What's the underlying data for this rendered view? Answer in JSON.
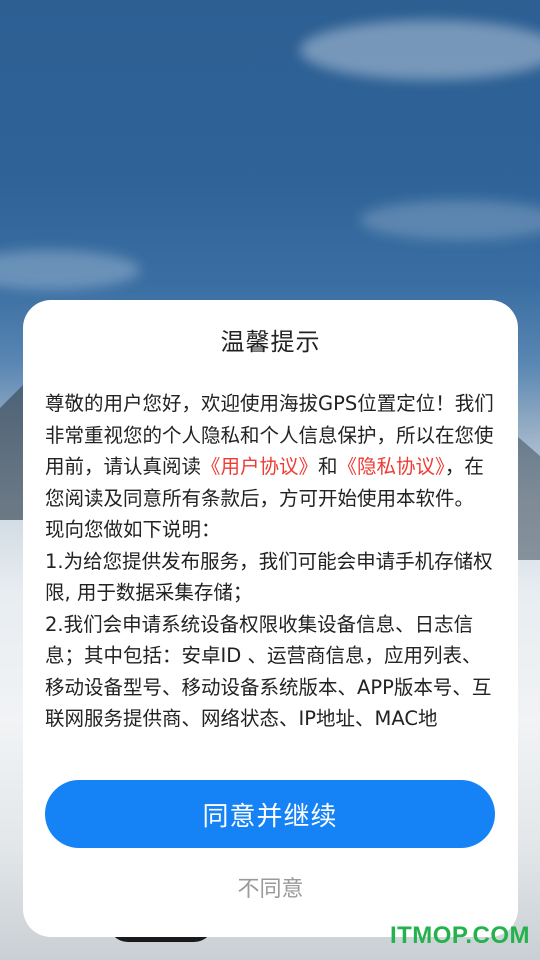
{
  "dialog": {
    "title": "温馨提示",
    "intro_before_links": "尊敬的用户您好，欢迎使用海拔GPS位置定位！我们非常重视您的个人隐私和个人信息保护，所以在您使用前，请认真阅读",
    "user_agreement_link": "《用户协议》",
    "and_text": "和",
    "privacy_link": "《隐私协议》",
    "intro_after_links": "，在您阅读及同意所有条款后，方可开始使用本软件。",
    "explain_heading": "现向您做如下说明：",
    "item1": "1.为给您提供发布服务，我们可能会申请手机存储权限, 用于数据采集存储；",
    "item2": "2.我们会申请系统设备权限收集设备信息、日志信息；其中包括：安卓ID 、运营商信息，应用列表、移动设备型号、移动设备系统版本、APP版本号、互联网服务提供商、网络状态、IP地址、MAC地",
    "agree_label": "同意并继续",
    "disagree_label": "不同意"
  },
  "watermark": "ITMOP.COM",
  "colors": {
    "accent": "#1583f6",
    "link": "#ee3b34",
    "watermark": "#23b24b"
  }
}
